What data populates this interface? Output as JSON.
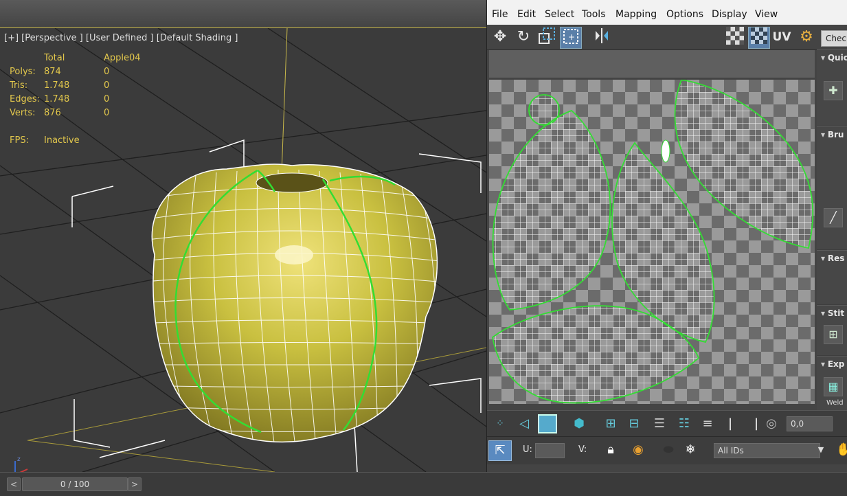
{
  "viewport": {
    "label": "[+] [Perspective ] [User Defined ] [Default Shading ]",
    "stats": {
      "header_total": "Total",
      "header_object": "Apple04",
      "rows": [
        {
          "label": "Polys:",
          "total": "874",
          "object": "0"
        },
        {
          "label": "Tris:",
          "total": "1.748",
          "object": "0"
        },
        {
          "label": "Edges:",
          "total": "1.748",
          "object": "0"
        },
        {
          "label": "Verts:",
          "total": "876",
          "object": "0"
        }
      ],
      "fps_label": "FPS:",
      "fps_value": "Inactive"
    },
    "colors": {
      "apple": "#c9c040",
      "wire": "#ffffff",
      "seam": "#33dd33",
      "stats": "#e3c84c"
    }
  },
  "timeline": {
    "prev": "<",
    "next": ">",
    "frame": "0 / 100"
  },
  "uv_editor": {
    "menu": [
      "File",
      "Edit",
      "Select",
      "Tools",
      "Mapping",
      "Options",
      "Display",
      "View"
    ],
    "uv_toggle": "UV",
    "checker_button": "Check",
    "rollouts": [
      {
        "title": "Quic"
      },
      {
        "title": "Bru"
      },
      {
        "title": "Res"
      },
      {
        "title": "Stit"
      },
      {
        "title": "Exp"
      }
    ],
    "weld_label": "Weld",
    "spinner_value": "0,0",
    "u_label": "U:",
    "v_label": "V:",
    "id_filter": "All IDs",
    "icons": [
      "move-icon",
      "rotate-icon",
      "scale-icon",
      "freeform-icon",
      "mirror-icon",
      "checker-pattern-icon",
      "checker-toggle-icon",
      "gear-icon",
      "lock-icon",
      "eye-icon",
      "snowflake-icon",
      "hand-icon"
    ]
  }
}
